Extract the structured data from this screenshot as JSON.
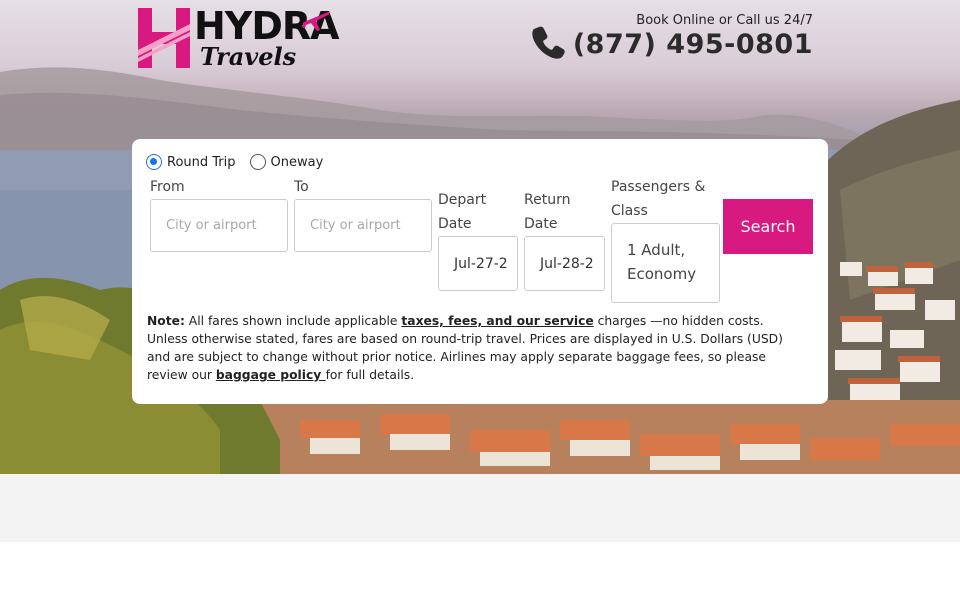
{
  "brand": {
    "name_top": "HYDRA",
    "name_bottom": "Travels",
    "mark_letter": "H",
    "accent_color": "#d8197f",
    "plane_icon": "airplane-icon"
  },
  "contact": {
    "tagline": "Book Online or Call us 24/7",
    "phone": "(877) 495-0801",
    "icon": "phone-icon"
  },
  "search": {
    "trip_types": [
      {
        "label": "Round Trip",
        "checked": true
      },
      {
        "label": "Oneway",
        "checked": false
      }
    ],
    "from_label": "From",
    "from_placeholder": "City or airport",
    "to_label": "To",
    "to_placeholder": "City or airport",
    "depart_label_1": "Depart",
    "depart_label_2": "Date",
    "depart_value": "Jul-27-2",
    "return_label_1": "Return",
    "return_label_2": "Date",
    "return_value": "Jul-28-2",
    "passengers_label_1": "Passengers &",
    "passengers_label_2": "Class",
    "passengers_value_1": "1 Adult,",
    "passengers_value_2": "Economy",
    "search_button": "Search"
  },
  "note": {
    "prefix": "Note:",
    "text_1": " All fares shown include applicable ",
    "link_1": "taxes, fees, and our service",
    "text_2": " charges —no hidden costs. Unless otherwise stated, fares are based on round-trip travel. Prices are displayed in U.S. Dollars (USD) and are subject to change without prior notice. Airlines may apply separate baggage fees, so please review our ",
    "link_2": "baggage policy ",
    "text_3": "for full details."
  }
}
